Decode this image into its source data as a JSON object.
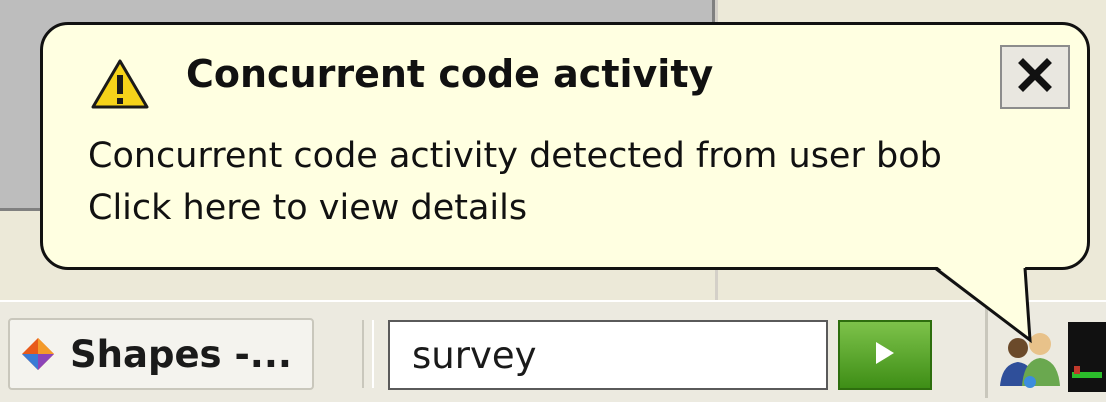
{
  "balloon": {
    "title": "Concurrent code activity",
    "message": "Concurrent code activity detected from user bob",
    "link_text": "Click here to view details",
    "close_icon": "close-icon",
    "warning_icon": "warning-icon",
    "background_color": "#ffffe1"
  },
  "taskbar": {
    "task_button_label": "Shapes -...",
    "task_button_icon": "shapes-app-icon",
    "search": {
      "value": "survey"
    },
    "go_button_icon": "play-arrow-icon",
    "go_button_color": "#4fa326",
    "tray_icons": [
      "users-icon",
      "monitor-icon"
    ]
  }
}
